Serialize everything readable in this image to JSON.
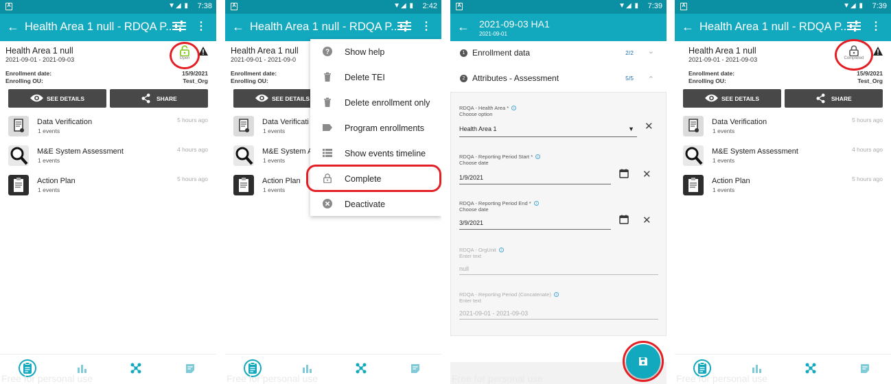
{
  "colors": {
    "primary": "#12a8bd",
    "status_bar": "#0b8fa3",
    "button": "#484848",
    "highlight_ring": "#e31e24"
  },
  "panels": [
    {
      "time": "7:38",
      "title": "Health Area 1 null - RDQA P...",
      "enrollment": {
        "name": "Health Area 1 null",
        "dates": "2021-09-01 - 2021-09-03",
        "enrollment_date_label": "Enrollment date:",
        "enrollment_date_value": "15/9/2021",
        "enrolling_ou_label": "Enrolling OU:",
        "enrolling_ou_value": "Test_Org",
        "status_label": "Open"
      },
      "buttons": {
        "details": "SEE DETAILS",
        "share": "SHARE"
      },
      "programs": [
        {
          "title": "Data Verification",
          "events": "1 events",
          "age": "5 hours ago",
          "icon": "document-icon"
        },
        {
          "title": "M&E System Assessment",
          "events": "1 events",
          "age": "4 hours ago",
          "icon": "magnifier-icon"
        },
        {
          "title": "Action Plan",
          "events": "1 events",
          "age": "5 hours ago",
          "icon": "clipboard-icon"
        }
      ],
      "watermark": "Free for personal use"
    },
    {
      "time": "2:42",
      "title": "Health Area 1 null - RDQA P...",
      "enrollment": {
        "name": "Health Area 1 null",
        "dates": "2021-09-01 - 2021-09-0",
        "enrollment_date_label": "Enrollment date:",
        "enrolling_ou_label": "Enrolling OU:"
      },
      "buttons": {
        "details": "SEE DETAILS"
      },
      "programs": [
        {
          "title": "Data Verificati",
          "events": "1 events"
        },
        {
          "title": "M&E System A",
          "events": "1 events"
        },
        {
          "title": "Action Plan",
          "events": "1 events"
        }
      ],
      "menu": [
        {
          "label": "Show help",
          "icon": "help-icon"
        },
        {
          "label": "Delete TEI",
          "icon": "trash-icon"
        },
        {
          "label": "Delete enrollment only",
          "icon": "trash-icon"
        },
        {
          "label": "Program enrollments",
          "icon": "label-icon"
        },
        {
          "label": "Show events timeline",
          "icon": "list-icon"
        },
        {
          "label": "Complete",
          "icon": "lock-icon"
        },
        {
          "label": "Deactivate",
          "icon": "cancel-icon"
        }
      ],
      "watermark": "Free for personal use"
    },
    {
      "time": "7:39",
      "title": "2021-09-03 HA1",
      "subtitle": "2021-09-01",
      "sections": [
        {
          "number": "1",
          "title": "Enrollment data",
          "count": "2/2",
          "chevron": "⌄"
        },
        {
          "number": "2",
          "title": "Attributes - Assessment",
          "count": "5/5",
          "chevron": "⌃"
        }
      ],
      "fields": [
        {
          "label": "RDQA - Health Area *",
          "hint": "Choose option",
          "value": "Health Area 1"
        },
        {
          "label": "RDQA - Reporting Period Start *",
          "hint": "Choose date",
          "value": "1/9/2021"
        },
        {
          "label": "RDQA - Reporting Period End *",
          "hint": "Choose date",
          "value": "3/9/2021"
        },
        {
          "label": "RDQA - OrgUnit",
          "hint": "Enter text",
          "value": "null"
        },
        {
          "label": "RDQA - Reporting Period (Concatenate)",
          "hint": "Enter text",
          "value": "2021-09-01 - 2021-09-03"
        }
      ],
      "watermark": "Free for personal use"
    },
    {
      "time": "7:39",
      "title": "Health Area 1 null - RDQA P...",
      "enrollment": {
        "name": "Health Area 1 null",
        "dates": "2021-09-01 - 2021-09-03",
        "enrollment_date_label": "Enrollment date:",
        "enrollment_date_value": "15/9/2021",
        "enrolling_ou_label": "Enrolling OU:",
        "enrolling_ou_value": "Test_Org",
        "status_label": "Completed"
      },
      "buttons": {
        "details": "SEE DETAILS",
        "share": "SHARE"
      },
      "programs": [
        {
          "title": "Data Verification",
          "events": "1 events",
          "age": "5 hours ago"
        },
        {
          "title": "M&E System Assessment",
          "events": "1 events",
          "age": "4 hours ago"
        },
        {
          "title": "Action Plan",
          "events": "1 events",
          "age": "5 hours ago"
        }
      ],
      "watermark": "Free for personal use"
    }
  ]
}
